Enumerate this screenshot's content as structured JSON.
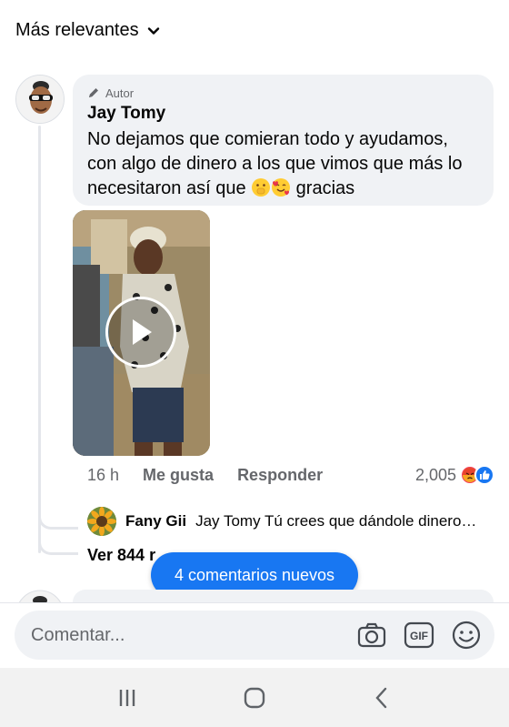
{
  "sort": {
    "label": "Más relevantes"
  },
  "comment": {
    "author_tag": "Autor",
    "author_name": "Jay Tomy",
    "text_before_emoji": "No dejamos que comieran todo y ayudamos, con algo de dinero a los que vimos que más lo necesitaron así que ",
    "text_after_emoji": " gracias",
    "emojis": [
      "hand-over-mouth-emoji",
      "smiling-face-with-hearts-emoji"
    ],
    "time": "16 h",
    "like_label": "Me gusta",
    "reply_label": "Responder",
    "reaction_count": "2,005",
    "reactions": [
      "angry-reaction",
      "like-reaction"
    ]
  },
  "reply": {
    "name": "Fany Gii",
    "text": "Jay Tomy Tú crees que dándole dinero…"
  },
  "view_more": {
    "label": "Ver 844 r"
  },
  "new_comments": {
    "label": "4 comentarios nuevos"
  },
  "composer": {
    "placeholder": "Comentar...",
    "icons": [
      "camera-icon",
      "gif-icon",
      "emoji-icon"
    ]
  },
  "navbar": {
    "icons": [
      "recents-icon",
      "home-icon",
      "back-icon"
    ]
  },
  "colors": {
    "accent": "#1877f2",
    "bubble": "#f0f2f5",
    "secondary_text": "#65676b",
    "angry": "#f33e58"
  }
}
